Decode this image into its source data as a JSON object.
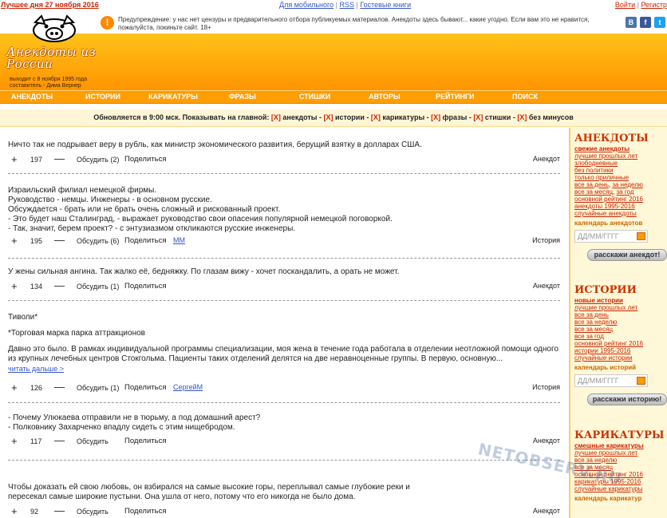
{
  "top": {
    "best_day": "Лучшее дня 27 ноября 2016",
    "links": [
      "Для мобильного",
      "RSS",
      "Гостевые книги"
    ],
    "auth": [
      "Войти",
      "Регистр"
    ]
  },
  "header": {
    "logo_title": "Анекдоты из России",
    "logo_sub1": "выходит с 8 ноября 1995 года",
    "logo_sub2": "составитель - Дима Вернер",
    "warning": "Предупреждение: у нас нет цензуры и предварительного отбора публикуемых материалов. Анекдоты здесь бывают... какие угодно. Если вам это не нравится, пожалуйста, покиньте сайт. 18+",
    "social": [
      {
        "name": "vk-icon",
        "label": "В",
        "color": "#4a76a8"
      },
      {
        "name": "facebook-icon",
        "label": "f",
        "color": "#3b5998"
      },
      {
        "name": "twitter-icon",
        "label": "t",
        "color": "#1da1f2"
      }
    ]
  },
  "nav": [
    "АНЕКДОТЫ",
    "ИСТОРИИ",
    "КАРИКАТУРЫ",
    "ФРАЗЫ",
    "СТИШКИ",
    "АВТОРЫ",
    "РЕЙТИНГИ",
    "ПОИСК"
  ],
  "filter": {
    "prefix": "Обновляется в 9:00 мск. Показывать на главной:",
    "mark": "[X]",
    "items": [
      "анекдоты",
      "истории",
      "карикатуры",
      "фразы",
      "стишки",
      "без минусов"
    ]
  },
  "posts": [
    {
      "lines": [
        "Ничто так не подрывает веру в рубль, как министр экономического развития, берущий взятку в долларах США."
      ],
      "votes": "197",
      "discuss": "Обсудить (2)",
      "share": "Поделиться",
      "author": "",
      "category": "Анекдот"
    },
    {
      "lines": [
        "Израильский филиал немецкой фирмы.",
        "Руководство - немцы. Инженеры - в основном русские.",
        "Обсуждается - брать или не брать очень сложный и рискованный проект.",
        "- Это будет наш Сталинград, - выражает руководство свои опасения популярной немецкой поговоркой.",
        "- Так, значит, берем проект? - с энтузиазмом откликаются русские инженеры."
      ],
      "votes": "195",
      "discuss": "Обсудить (6)",
      "share": "Поделиться",
      "author": "MM",
      "category": "История"
    },
    {
      "lines": [
        "У жены сильная ангина. Так жалко её, бедняжку. По глазам вижу - хочет поскандалить, а орать не может."
      ],
      "votes": "134",
      "discuss": "Обсудить (1)",
      "share": "Поделиться",
      "author": "",
      "category": "Анекдот"
    },
    {
      "lines": [
        "Тиволи*",
        "",
        "*Торговая марка парка аттракционов",
        "",
        "Давно это было. В рамках индивидуальной программы специализации, моя жена в течение года работала в отделении неотложной помощи одного из крупных лечебных центров Стокгольма. Пациенты таких отделений делятся на две неравноценные группы. В первую, основную..."
      ],
      "readmore": "читать дальше >",
      "votes": "126",
      "discuss": "Обсудить (1)",
      "share": "Поделиться",
      "author": "СергейМ",
      "category": "История"
    },
    {
      "lines": [
        "- Почему Улюкаева отправили не в тюрьму, а под домашний арест?",
        "- Полковнику Захарченко впадлу сидеть с этим нищебродом."
      ],
      "votes": "117",
      "discuss": "Обсудить",
      "share": "Поделиться",
      "author": "",
      "category": "Анекдот"
    },
    {
      "lines": [
        "Чтобы доказать ей свою любовь, он взбирался на самые высокие горы, переплывал самые глубокие реки и",
        "пересекал самые широкие пустыни. Она ушла от него, потому что его никогда не было дома."
      ],
      "votes": "92",
      "discuss": "Обсудить",
      "share": "Поделиться",
      "author": "",
      "category": "Анекдот"
    }
  ],
  "sidebar": {
    "anekdoty": {
      "title": "АНЕКДОТЫ",
      "links": [
        "свежие анекдоты",
        "лучшие прошлых лет",
        "злободневные",
        "без политики",
        "только приличные",
        "все за день",
        "за неделю",
        "все за месяц",
        "за год",
        "основной рейтинг 2016",
        "анекдоты 1995-2016",
        "случайные анекдоты"
      ],
      "calendar": "календарь анекдотов",
      "date_placeholder": "ДД/ММ/ГГГГ",
      "button": "расскажи анекдот!"
    },
    "istorii": {
      "title": "ИСТОРИИ",
      "links": [
        "новые истории",
        "лучшие прошлых лет",
        "все за день",
        "все за неделю",
        "все за месяц",
        "все за год",
        "основной рейтинг 2016",
        "истории 1995-2016",
        "случайные истории"
      ],
      "calendar": "календарь историй",
      "date_placeholder": "ДД/ММ/ГГГГ",
      "button": "расскажи историю!"
    },
    "karikatury": {
      "title": "КАРИКАТУРЫ",
      "links": [
        "смешные карикатуры",
        "лучшие прошлых лет",
        "все за неделю",
        "все за месяц",
        "основной рейтинг 2016",
        "карикатуры 1995-2016",
        "случайные карикатуры"
      ],
      "calendar": "календарь карикатур"
    }
  },
  "watermark": "NETOBSERV.RU"
}
